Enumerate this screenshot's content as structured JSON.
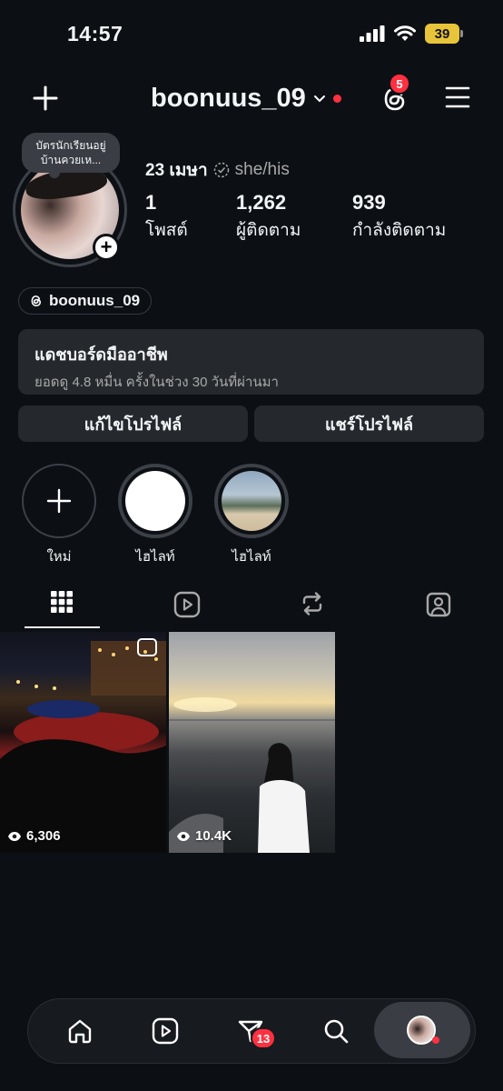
{
  "status_bar": {
    "time": "14:57",
    "battery": "39"
  },
  "header": {
    "username": "boonuus_09",
    "threads_badge": "5"
  },
  "profile": {
    "note": "บัตรนักเรียนอยู่บ้านควยเห...",
    "display_name": "23 เมษา",
    "pronouns": "she/his",
    "stats": [
      {
        "value": "1",
        "label": "โพสต์"
      },
      {
        "value": "1,262",
        "label": "ผู้ติดตาม"
      },
      {
        "value": "939",
        "label": "กำลังติดตาม"
      }
    ],
    "threads_handle": "boonuus_09"
  },
  "dashboard": {
    "title": "แดชบอร์ดมืออาชีพ",
    "subtitle": "ยอดดู 4.8 หมื่น ครั้งในช่วง 30 วันที่ผ่านมา"
  },
  "buttons": {
    "edit": "แก้ไขโปรไฟล์",
    "share": "แชร์โปรไฟล์"
  },
  "highlights": [
    {
      "label": "ใหม่"
    },
    {
      "label": "ไฮไลท์"
    },
    {
      "label": "ไฮไลท์"
    }
  ],
  "posts": [
    {
      "views": "6,306"
    },
    {
      "views": "10.4K"
    }
  ],
  "bottom_nav": {
    "messages_badge": "13"
  },
  "colors": {
    "background": "#0c1015",
    "accent_red": "#ff3040",
    "surface": "#25292e"
  }
}
